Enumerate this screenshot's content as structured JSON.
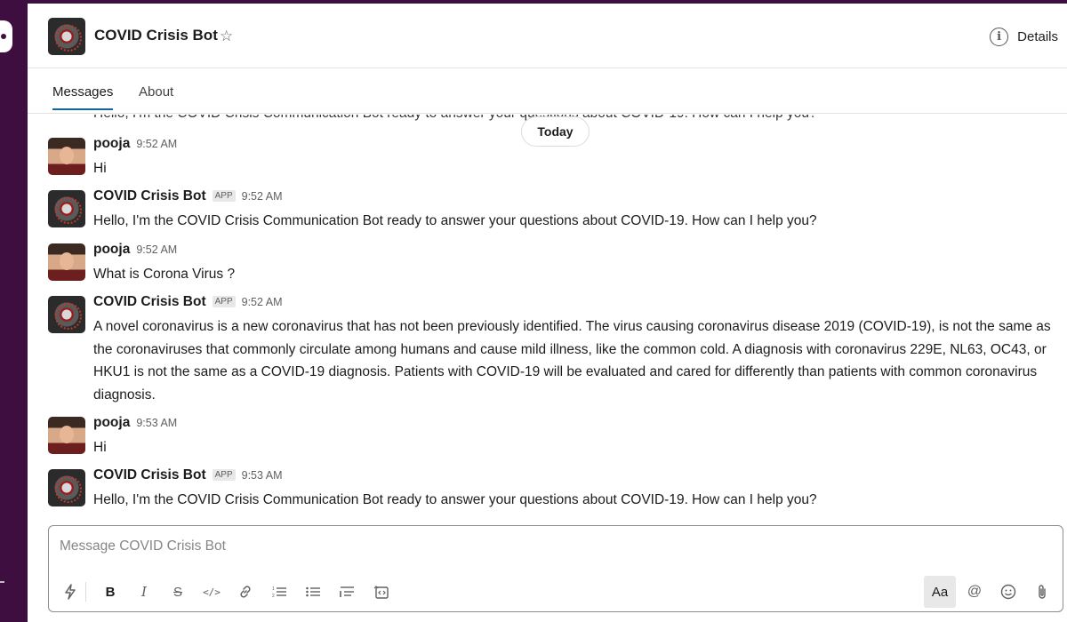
{
  "channel": {
    "title": "COVID Crisis Bot",
    "details_label": "Details"
  },
  "tabs": [
    {
      "label": "Messages"
    },
    {
      "label": "About"
    }
  ],
  "clipped_message": "Hello, I'm the COVID Crisis Communication Bot ready to answer your questions about COVID-19. How can I help you?",
  "today_label": "Today",
  "app_badge": "APP",
  "messages": [
    {
      "name": "pooja",
      "time": "9:52 AM",
      "text": "Hi",
      "is_bot": false
    },
    {
      "name": "COVID Crisis Bot",
      "time": "9:52 AM",
      "text": "Hello, I'm the COVID Crisis Communication Bot ready to answer your questions about COVID-19. How can I help you?",
      "is_bot": true
    },
    {
      "name": "pooja",
      "time": "9:52 AM",
      "text": "What is Corona Virus ?",
      "is_bot": false
    },
    {
      "name": "COVID Crisis Bot",
      "time": "9:52 AM",
      "text": "A novel coronavirus is a new coronavirus that has not been previously identified. The virus causing coronavirus disease 2019 (COVID-19), is not the same as the coronaviruses that commonly circulate among humans and cause mild illness, like the common cold. A diagnosis with coronavirus 229E, NL63, OC43, or HKU1 is not the same as a COVID-19 diagnosis. Patients with COVID-19 will be evaluated and cared for differently than patients with common coronavirus diagnosis.",
      "is_bot": true
    },
    {
      "name": "pooja",
      "time": "9:53 AM",
      "text": "Hi",
      "is_bot": false
    },
    {
      "name": "COVID Crisis Bot",
      "time": "9:53 AM",
      "text": "Hello, I'm the COVID Crisis Communication Bot ready to answer your questions about COVID-19. How can I help you?",
      "is_bot": true
    }
  ],
  "composer": {
    "placeholder": "Message COVID Crisis Bot",
    "value": ""
  },
  "toolbar": {
    "shortcuts_icon": "lightning-icon",
    "bold_icon": "B",
    "italic_icon": "I",
    "strike_icon": "S",
    "code_icon": "</>",
    "link_icon": "link-icon",
    "ordered_list_icon": "ordered-list-icon",
    "bulleted_list_icon": "bulleted-list-icon",
    "blockquote_icon": "blockquote-icon",
    "code_block_icon": "code-block-icon",
    "formatting_label": "Aa",
    "mention_icon": "@",
    "emoji_icon": "emoji-icon",
    "attach_icon": "paperclip-icon"
  }
}
